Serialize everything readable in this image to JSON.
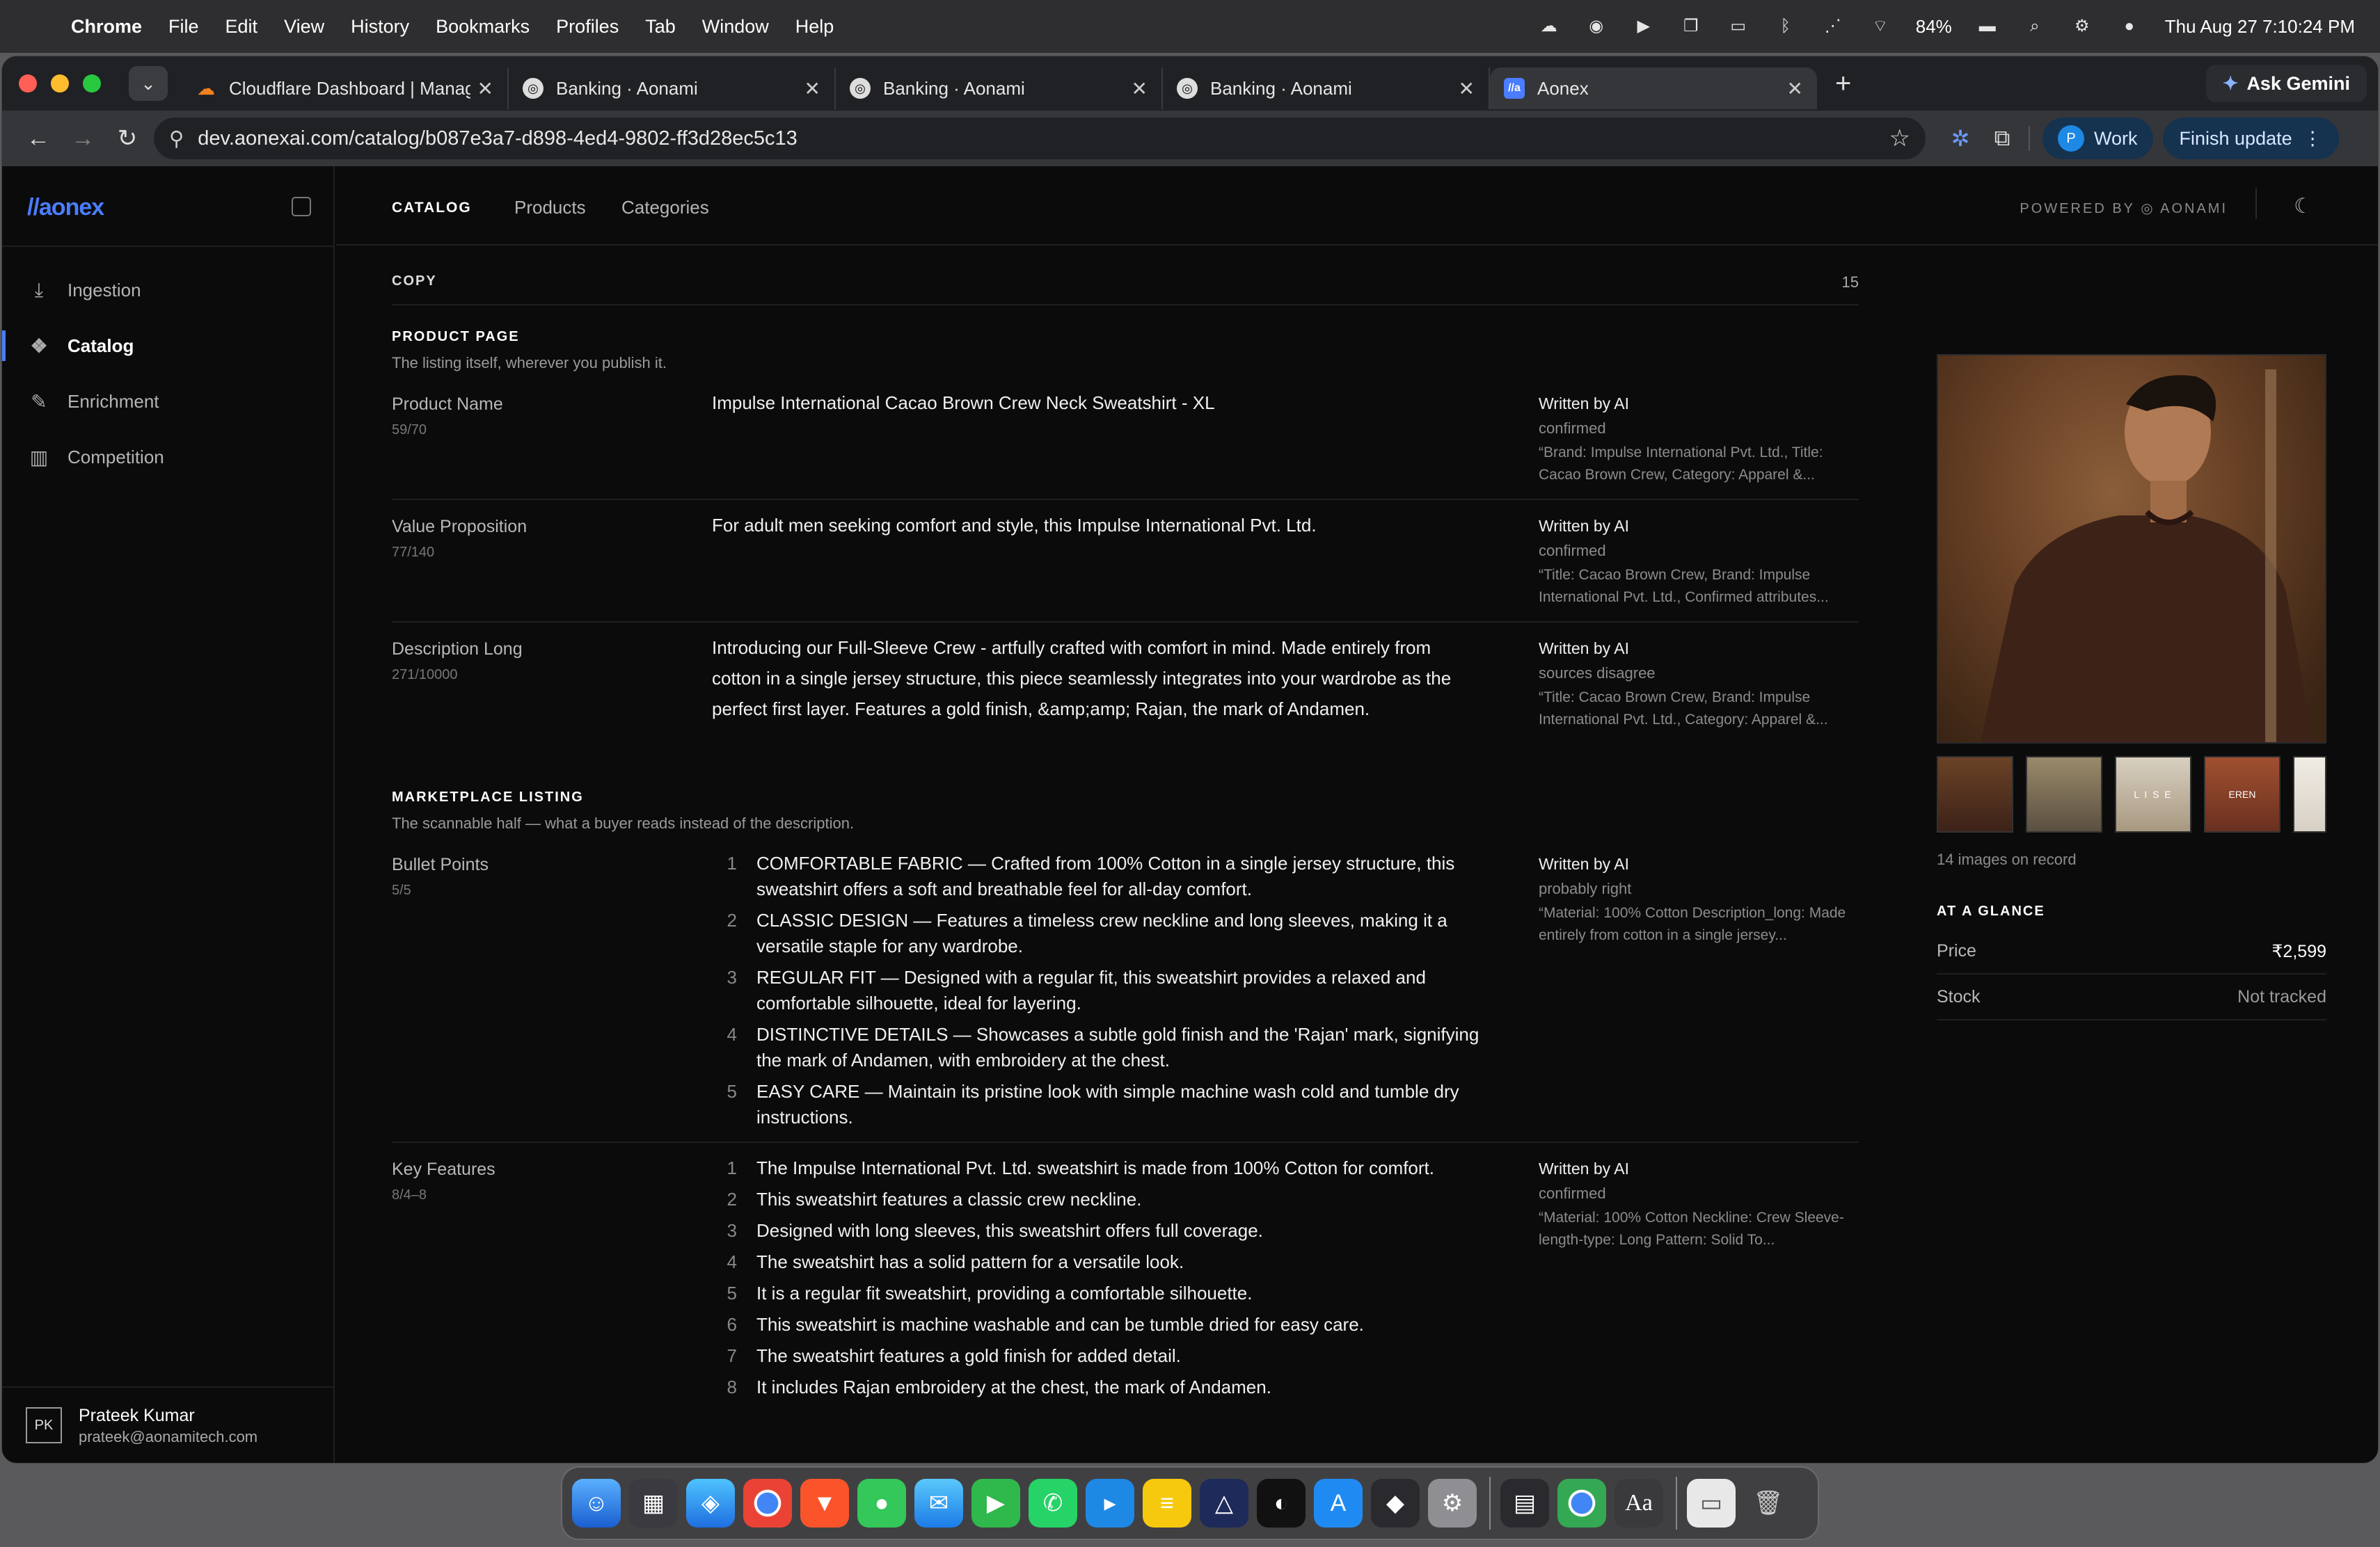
{
  "menubar": {
    "app": "Chrome",
    "items": [
      "File",
      "Edit",
      "View",
      "History",
      "Bookmarks",
      "Profiles",
      "Tab",
      "Window",
      "Help"
    ],
    "battery": "84%",
    "datetime": "Thu Aug 27  7:10:24 PM"
  },
  "tabs": [
    {
      "title": "Cloudflare Dashboard | Manage",
      "icon": "cloudflare-icon"
    },
    {
      "title": "Banking · Aonami",
      "icon": "aonami-icon"
    },
    {
      "title": "Banking · Aonami",
      "icon": "aonami-icon"
    },
    {
      "title": "Banking · Aonami",
      "icon": "aonami-icon"
    },
    {
      "title": "Aonex",
      "icon": "aonex-icon"
    }
  ],
  "gemini": "Ask Gemini",
  "url": "dev.aonexai.com/catalog/b087e3a7-d898-4ed4-9802-ff3d28ec5c13",
  "profile": {
    "initial": "P",
    "label": "Work"
  },
  "finish_update": "Finish update",
  "sidebar": {
    "logo": "//aonex",
    "items": [
      {
        "label": "Ingestion",
        "icon": "download-icon"
      },
      {
        "label": "Catalog",
        "icon": "catalog-icon"
      },
      {
        "label": "Enrichment",
        "icon": "pen-icon"
      },
      {
        "label": "Competition",
        "icon": "bar-chart-icon"
      }
    ],
    "user": {
      "initials": "PK",
      "name": "Prateek Kumar",
      "email": "prateek@aonamitech.com"
    }
  },
  "topnav": {
    "catalog": "CATALOG",
    "products": "Products",
    "categories": "Categories",
    "powered": "POWERED BY  ◎  AONAMI"
  },
  "copy": {
    "title": "COPY",
    "count": "15"
  },
  "product_page": {
    "title": "PRODUCT PAGE",
    "subtitle": "The listing itself, wherever you publish it."
  },
  "fields": [
    {
      "label": "Product Name",
      "count": "59/70",
      "value": "Impulse International Cacao Brown Crew Neck Sweatshirt - XL",
      "by": "Written by AI",
      "status": "confirmed",
      "quote": "“Brand: Impulse International Pvt. Ltd., Title: Cacao Brown Crew, Category: Apparel &..."
    },
    {
      "label": "Value Proposition",
      "count": "77/140",
      "value": "For adult men seeking comfort and style, this Impulse International Pvt. Ltd.",
      "by": "Written by AI",
      "status": "confirmed",
      "quote": "“Title: Cacao Brown Crew, Brand: Impulse International Pvt. Ltd., Confirmed attributes..."
    },
    {
      "label": "Description Long",
      "count": "271/10000",
      "value": "Introducing our Full-Sleeve Crew - artfully crafted with comfort in mind. Made entirely from cotton in a single jersey structure, this piece seamlessly integrates into your wardrobe as the perfect first layer. Features a gold finish, &amp;amp; Rajan, the mark of Andamen.",
      "by": "Written by AI",
      "status": "sources disagree",
      "quote": "“Title: Cacao Brown Crew, Brand: Impulse International Pvt. Ltd., Category: Apparel &..."
    }
  ],
  "marketplace": {
    "title": "MARKETPLACE LISTING",
    "subtitle": "The scannable half — what a buyer reads instead of the description."
  },
  "bullets": {
    "label": "Bullet Points",
    "count": "5/5",
    "by": "Written by AI",
    "status": "probably right",
    "quote": "“Material: 100% Cotton Description_long: Made entirely from cotton in a single jersey...",
    "items": [
      "COMFORTABLE FABRIC — Crafted from 100% Cotton in a single jersey structure, this sweatshirt offers a soft and breathable feel for all-day comfort.",
      "CLASSIC DESIGN — Features a timeless crew neckline and long sleeves, making it a versatile staple for any wardrobe.",
      "REGULAR FIT — Designed with a regular fit, this sweatshirt provides a relaxed and comfortable silhouette, ideal for layering.",
      "DISTINCTIVE DETAILS — Showcases a subtle gold finish and the 'Rajan' mark, signifying the mark of Andamen, with embroidery at the chest.",
      "EASY CARE — Maintain its pristine look with simple machine wash cold and tumble dry instructions."
    ]
  },
  "features": {
    "label": "Key Features",
    "count": "8/4–8",
    "by": "Written by AI",
    "status": "confirmed",
    "quote": "“Material: 100% Cotton Neckline: Crew Sleeve-length-type: Long Pattern: Solid To...",
    "items": [
      "The Impulse International Pvt. Ltd. sweatshirt is made from 100% Cotton for comfort.",
      "This sweatshirt features a classic crew neckline.",
      "Designed with long sleeves, this sweatshirt offers full coverage.",
      "The sweatshirt has a solid pattern for a versatile look.",
      "It is a regular fit sweatshirt, providing a comfortable silhouette.",
      "This sweatshirt is machine washable and can be tumble dried for easy care.",
      "The sweatshirt features a gold finish for added detail.",
      "It includes Rajan embroidery at the chest, the mark of Andamen."
    ]
  },
  "gallery": {
    "count": "14 images on record",
    "thumb_text": [
      "L I S E",
      "EREN"
    ]
  },
  "glance": {
    "title": "AT A GLANCE",
    "price_label": "Price",
    "price": "₹2,599",
    "stock_label": "Stock",
    "stock": "Not tracked"
  },
  "colors": {
    "accent": "#4a7dff",
    "background": "#0b0b0c",
    "tab_bar": "#202124"
  }
}
